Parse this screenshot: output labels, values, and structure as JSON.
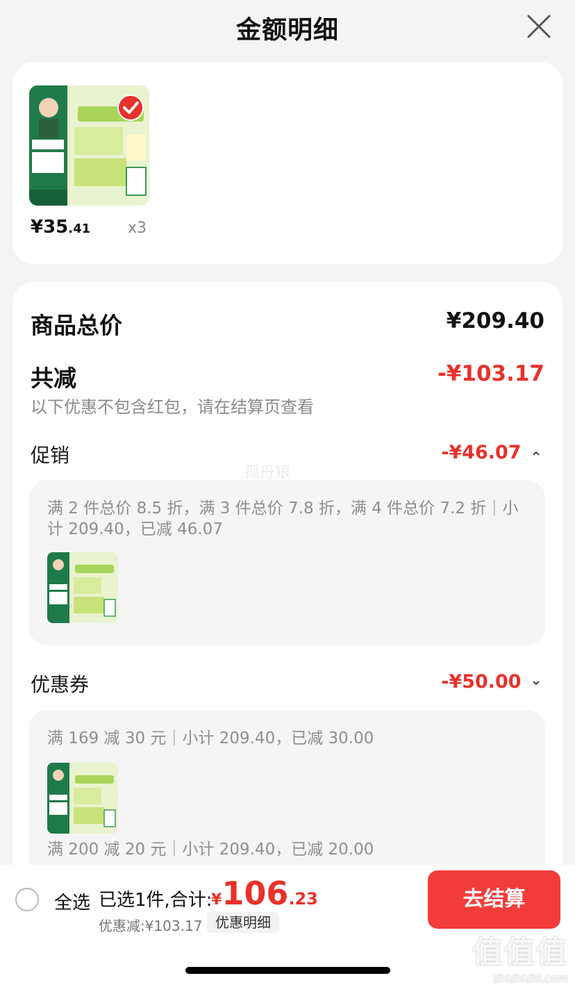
{
  "header": {
    "title": "金额明细"
  },
  "product": {
    "price_int": "¥35",
    "price_dec": ".41",
    "qty": "x3"
  },
  "summary": {
    "total_label": "商品总价",
    "total_value": "¥209.40",
    "reduce_label": "共减",
    "reduce_value": "-¥103.17",
    "note": "以下优惠不包含红包，请在结算页查看"
  },
  "promotion": {
    "label": "促销",
    "value": "-¥46.07",
    "detail_line1": "满 2 件总价 8.5 折，满 3 件总价 7.8 折，满 4 件总价 7.2 折｜小",
    "detail_line2": "计 209.40，已减 46.07"
  },
  "coupon": {
    "label": "优惠券",
    "value": "-¥50.00",
    "detail1": "满 169 减 30 元｜小计 209.40，已减 30.00",
    "detail2": "满 200 减 20 元｜小计 209.40，已减 20.00"
  },
  "watermark": "孤丹狼",
  "bottom": {
    "select_all": "全选",
    "selected": "已选1件,合计:",
    "total_cur": "¥",
    "total_int": "106",
    "total_dec": ".23",
    "discount": "优惠减:¥103.17",
    "detail_btn": "优惠明细",
    "checkout": "去结算"
  },
  "site_watermark": {
    "logo": "值值值",
    "url": "zhizhizhi.com"
  },
  "colors": {
    "accent": "#e8322b",
    "checkout_bg": "#f33d3a"
  }
}
